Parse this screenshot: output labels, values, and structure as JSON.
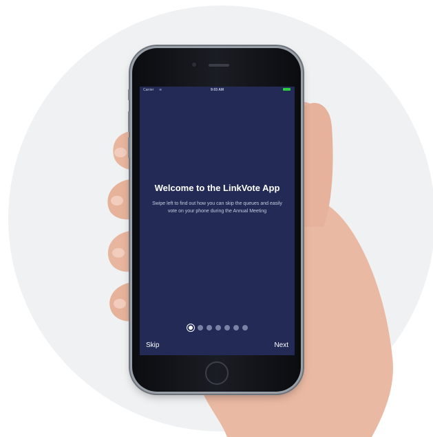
{
  "status_bar": {
    "carrier": "Carrier",
    "wifi_icon": "wifi-icon",
    "time": "9:03 AM",
    "battery_icon": "battery-icon"
  },
  "onboarding": {
    "title": "Welcome to the LinkVote App",
    "body": "Swipe left to find out how you can skip the queues and easily vote on your phone during the Annual Meeting",
    "page_count": 7,
    "current_page": 1,
    "skip_label": "Skip",
    "next_label": "Next"
  },
  "colors": {
    "screen_background": "#222a55",
    "background_circle": "#eff1f3",
    "dot_inactive": "#7b82a6",
    "battery": "#2ecc40"
  }
}
